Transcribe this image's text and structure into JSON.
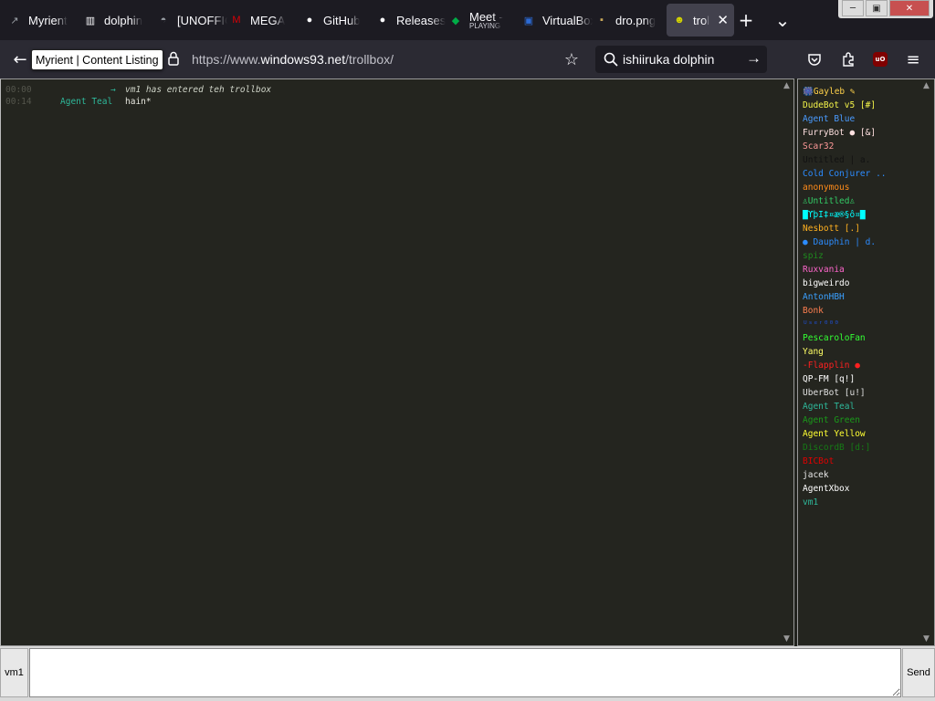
{
  "tabs": [
    {
      "label": "Myrient",
      "icon": "myrient-icon",
      "icon_glyph": "↗",
      "icon_color": "#9aa0a6"
    },
    {
      "label": "dolphin",
      "icon": "archive-icon",
      "icon_glyph": "▥",
      "icon_color": "#fbfbfe"
    },
    {
      "label": "[UNOFFICIAL]",
      "icon": "controller-icon",
      "icon_glyph": "◓",
      "icon_color": "#9aa0a6"
    },
    {
      "label": "MEGA",
      "icon": "mega-icon",
      "icon_glyph": "M",
      "icon_color": "#d90007"
    },
    {
      "label": "GitHub",
      "icon": "github-icon",
      "icon_glyph": "●",
      "icon_color": "#fbfbfe"
    },
    {
      "label": "Releases",
      "icon": "github-icon",
      "icon_glyph": "●",
      "icon_color": "#fbfbfe"
    },
    {
      "label": "Meet -",
      "sublabel": "PLAYING",
      "icon": "meet-icon",
      "icon_glyph": "◆",
      "icon_color": "#00ac47"
    },
    {
      "label": "VirtualBox",
      "icon": "virtualbox-icon",
      "icon_glyph": "▣",
      "icon_color": "#2c6bd6"
    },
    {
      "label": "dro.png",
      "icon": "image-icon",
      "icon_glyph": "▪",
      "icon_color": "#c8a85a"
    },
    {
      "label": "trollbox",
      "icon": "trollbox-icon",
      "icon_glyph": "☻",
      "icon_color": "#d6d600",
      "active": true
    }
  ],
  "new_tab_label": "+",
  "list_tabs_label": "⌄",
  "nav": {
    "tooltip": "Myrient | Content Listing",
    "url_prefix": "https://www.",
    "url_host": "windows93.net",
    "url_path": "/trollbox/",
    "search_text": "ishiiruka dolphin"
  },
  "chat": {
    "messages": [
      {
        "type": "system",
        "time": "00:00",
        "arrow": "→",
        "text": "vm1 has entered teh trollbox"
      },
      {
        "type": "message",
        "time": "00:14",
        "nick": "Agent Teal",
        "text": "hain*"
      }
    ]
  },
  "users": [
    {
      "name": "🎆Gayleb ✎",
      "color": "#ffd24a"
    },
    {
      "name": "DudeBot v5 [#]",
      "color": "#f5f54a"
    },
    {
      "name": "Agent Blue",
      "color": "#4a9bff"
    },
    {
      "name": "FurryBot ● [&]",
      "color": "#ffe0e0"
    },
    {
      "name": "Scar32",
      "color": "#ff9999"
    },
    {
      "name": "Untitled | a.",
      "color": "#111111"
    },
    {
      "name": "Cold Conjurer ..",
      "color": "#2c8cff"
    },
    {
      "name": "anonymous",
      "color": "#ff8c1a"
    },
    {
      "name": "♙Untitled♙",
      "color": "#33cc66"
    },
    {
      "name": "█ϒþΙ‡¤æ®§ô¤█",
      "color": "#00ffff"
    },
    {
      "name": "Nesbott [.]",
      "color": "#ffb020"
    },
    {
      "name": "● Dauphin | d.",
      "color": "#2c8cff"
    },
    {
      "name": "spiz",
      "color": "#1e8a1e"
    },
    {
      "name": "Ruxvania",
      "color": "#ff66cc"
    },
    {
      "name": "bigweirdo",
      "color": "#ffffff"
    },
    {
      "name": "AntonHBH",
      "color": "#3aa0ff"
    },
    {
      "name": "Bonk",
      "color": "#ff7f50"
    },
    {
      "name": "ᵁˢᵉʳ⁰⁰⁰",
      "color": "#1f4fd0"
    },
    {
      "name": "PescaroloFan",
      "color": "#33ff33"
    },
    {
      "name": "Yang",
      "color": "#ffff66"
    },
    {
      "name": "-Flapplin ●",
      "color": "#ff2020"
    },
    {
      "name": "QP-FM [q!]",
      "color": "#ffffff"
    },
    {
      "name": "ÜberBot [u!]",
      "color": "#e0e0e0"
    },
    {
      "name": "Agent Teal",
      "color": "#2eb89a"
    },
    {
      "name": "Agent Green",
      "color": "#1a9a1a"
    },
    {
      "name": "Agent Yellow",
      "color": "#ffff33"
    },
    {
      "name": "DiscordB [d:]",
      "color": "#157a15"
    },
    {
      "name": "BICBot",
      "color": "#e00000"
    },
    {
      "name": "jacek",
      "color": "#e8e8e8"
    },
    {
      "name": "AgentXbox",
      "color": "#ffffff"
    },
    {
      "name": "vm1",
      "color": "#2eb89a"
    }
  ],
  "input": {
    "nick_label": "vm1",
    "send_label": "Send",
    "value": ""
  }
}
